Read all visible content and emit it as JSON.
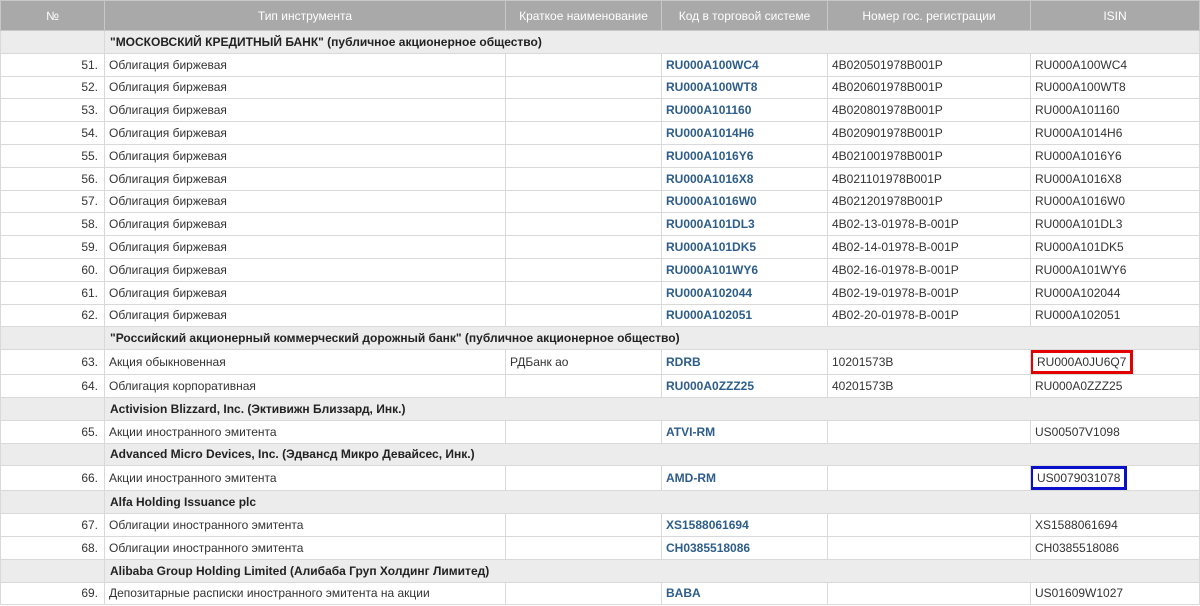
{
  "columns": {
    "num": "№",
    "type": "Тип инструмента",
    "short_name": "Краткое наименование",
    "code": "Код в торговой системе",
    "reg": "Номер гос. регистрации",
    "isin": "ISIN"
  },
  "groups": [
    {
      "issuer": "\"МОСКОВСКИЙ КРЕДИТНЫЙ БАНК\" (публичное акционерное общество)",
      "rows": [
        {
          "num": "51.",
          "type": "Облигация биржевая",
          "short_name": "",
          "code": "RU000A100WC4",
          "reg": "4B020501978B001P",
          "isin": "RU000A100WC4"
        },
        {
          "num": "52.",
          "type": "Облигация биржевая",
          "short_name": "",
          "code": "RU000A100WT8",
          "reg": "4B020601978B001P",
          "isin": "RU000A100WT8"
        },
        {
          "num": "53.",
          "type": "Облигация биржевая",
          "short_name": "",
          "code": "RU000A101160",
          "reg": "4B020801978B001P",
          "isin": "RU000A101160"
        },
        {
          "num": "54.",
          "type": "Облигация биржевая",
          "short_name": "",
          "code": "RU000A1014H6",
          "reg": "4B020901978B001P",
          "isin": "RU000A1014H6"
        },
        {
          "num": "55.",
          "type": "Облигация биржевая",
          "short_name": "",
          "code": "RU000A1016Y6",
          "reg": "4B021001978B001P",
          "isin": "RU000A1016Y6"
        },
        {
          "num": "56.",
          "type": "Облигация биржевая",
          "short_name": "",
          "code": "RU000A1016X8",
          "reg": "4B021101978B001P",
          "isin": "RU000A1016X8"
        },
        {
          "num": "57.",
          "type": "Облигация биржевая",
          "short_name": "",
          "code": "RU000A1016W0",
          "reg": "4B021201978B001P",
          "isin": "RU000A1016W0"
        },
        {
          "num": "58.",
          "type": "Облигация биржевая",
          "short_name": "",
          "code": "RU000A101DL3",
          "reg": "4B02-13-01978-B-001P",
          "isin": "RU000A101DL3"
        },
        {
          "num": "59.",
          "type": "Облигация биржевая",
          "short_name": "",
          "code": "RU000A101DK5",
          "reg": "4B02-14-01978-B-001P",
          "isin": "RU000A101DK5"
        },
        {
          "num": "60.",
          "type": "Облигация биржевая",
          "short_name": "",
          "code": "RU000A101WY6",
          "reg": "4B02-16-01978-B-001P",
          "isin": "RU000A101WY6"
        },
        {
          "num": "61.",
          "type": "Облигация биржевая",
          "short_name": "",
          "code": "RU000A102044",
          "reg": "4B02-19-01978-B-001P",
          "isin": "RU000A102044"
        },
        {
          "num": "62.",
          "type": "Облигация биржевая",
          "short_name": "",
          "code": "RU000A102051",
          "reg": "4B02-20-01978-B-001P",
          "isin": "RU000A102051"
        }
      ]
    },
    {
      "issuer": "\"Российский акционерный коммерческий дорожный банк\" (публичное акционерное общество)",
      "rows": [
        {
          "num": "63.",
          "type": "Акция обыкновенная",
          "short_name": "РДБанк ао",
          "code": "RDRB",
          "reg": "10201573B",
          "isin": "RU000A0JU6Q7",
          "highlight": "red"
        },
        {
          "num": "64.",
          "type": "Облигация корпоративная",
          "short_name": "",
          "code": "RU000A0ZZZ25",
          "reg": "40201573B",
          "isin": "RU000A0ZZZ25"
        }
      ]
    },
    {
      "issuer": "Activision Blizzard, Inc. (Эктивижн Близзард, Инк.)",
      "rows": [
        {
          "num": "65.",
          "type": "Акции иностранного эмитента",
          "short_name": "",
          "code": "ATVI-RM",
          "reg": "",
          "isin": "US00507V1098"
        }
      ]
    },
    {
      "issuer": "Advanced Micro Devices, Inc. (Эдвансд Микро Девайсес, Инк.)",
      "rows": [
        {
          "num": "66.",
          "type": "Акции иностранного эмитента",
          "short_name": "",
          "code": "AMD-RM",
          "reg": "",
          "isin": "US0079031078",
          "highlight": "blue"
        }
      ]
    },
    {
      "issuer": "Alfa Holding Issuance plc",
      "rows": [
        {
          "num": "67.",
          "type": "Облигации иностранного эмитента",
          "short_name": "",
          "code": "XS1588061694",
          "reg": "",
          "isin": "XS1588061694"
        },
        {
          "num": "68.",
          "type": "Облигации иностранного эмитента",
          "short_name": "",
          "code": "CH0385518086",
          "reg": "",
          "isin": "CH0385518086"
        }
      ]
    },
    {
      "issuer": "Alibaba Group Holding Limited (Алибаба Груп Холдинг Лимитед)",
      "rows": [
        {
          "num": "69.",
          "type": "Депозитарные расписки иностранного эмитента на акции",
          "short_name": "",
          "code": "BABA",
          "reg": "",
          "isin": "US01609W1027"
        }
      ]
    }
  ],
  "colors": {
    "header_bg": "#a9a9a9",
    "group_bg": "#ececec",
    "link": "#2d5d8a",
    "highlight_red": "#e30000",
    "highlight_blue": "#0a10c9"
  }
}
